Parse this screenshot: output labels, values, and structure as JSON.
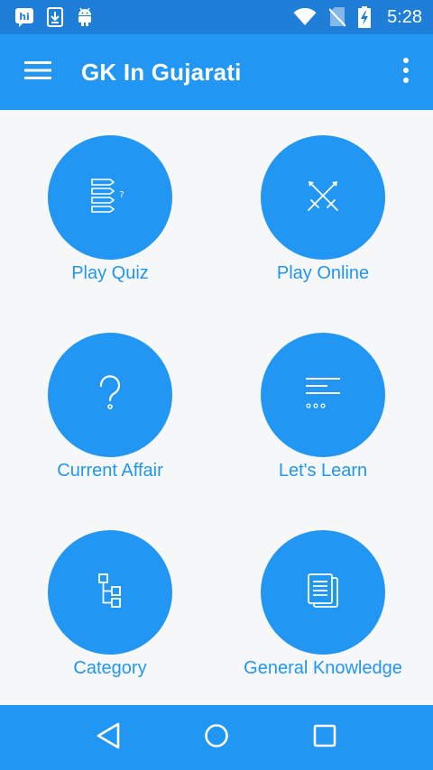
{
  "status_bar": {
    "time": "5:28",
    "left_icons": [
      "hike-icon",
      "download-icon",
      "android-icon"
    ],
    "right_icons": [
      "wifi-icon",
      "no-sim-icon",
      "battery-charging-icon"
    ]
  },
  "app_bar": {
    "title": "GK In Gujarati",
    "menu_icon": "hamburger-menu-icon",
    "overflow_icon": "more-vertical-icon"
  },
  "tiles": [
    {
      "label": "Play Quiz",
      "icon": "quiz-list-icon"
    },
    {
      "label": "Play Online",
      "icon": "crossed-swords-icon"
    },
    {
      "label": "Current Affair",
      "icon": "question-mark-icon"
    },
    {
      "label": "Let's Learn",
      "icon": "text-lines-icon"
    },
    {
      "label": "Category",
      "icon": "tree-hierarchy-icon"
    },
    {
      "label": "General Knowledge",
      "icon": "document-icon"
    }
  ],
  "nav_bar": {
    "icons": [
      "back-icon",
      "home-icon",
      "recents-icon"
    ]
  },
  "colors": {
    "primary": "#2196f3",
    "status_bar": "#1f7fd8",
    "background": "#f6f7f9",
    "label_text": "#2196f3"
  }
}
